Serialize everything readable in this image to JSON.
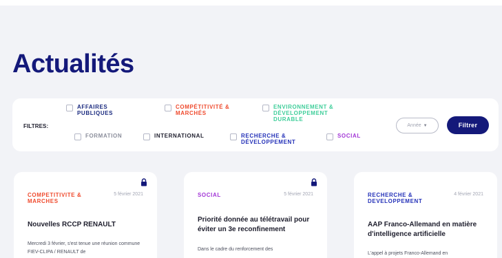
{
  "page": {
    "title": "Actualités"
  },
  "filters": {
    "label": "FILTRES:",
    "items": [
      {
        "label": "AFFAIRES PUBLIQUES"
      },
      {
        "label": "COMPÉTITIVITÉ & MARCHÉS"
      },
      {
        "label": "ENVIRONNEMENT & DÉVELOPPEMENT DURABLE"
      },
      {
        "label": "FORMATION"
      },
      {
        "label": "INTERNATIONAL"
      },
      {
        "label": "RECHERCHE & DÉVELOPPEMENT"
      },
      {
        "label": "SOCIAL"
      }
    ],
    "year_select": {
      "value": "Année"
    },
    "submit_label": "Filtrer"
  },
  "articles": [
    {
      "category": "COMPETITIVITE & MARCHES",
      "date": "5 février 2021",
      "locked": true,
      "title": "Nouvelles RCCP RENAULT",
      "excerpt": "Mercredi 3 février, s'est tenue une réunion commune FIEV-CLIPA / RENAULT de"
    },
    {
      "category": "SOCIAL",
      "date": "5 février 2021",
      "locked": true,
      "title": "Priorité donnée au télétravail pour éviter un 3e reconfinement",
      "excerpt": "Dans le cadre du renforcement des"
    },
    {
      "category": "RECHERCHE & DEVELOPPEMENT",
      "date": "4 février 2021",
      "locked": false,
      "title": "AAP Franco-Allemand en matière d'intelligence artificielle",
      "excerpt": "L'appel à projets Franco-Allemand en"
    }
  ],
  "colors": {
    "brand": "#14197a",
    "background": "#f2f3f7",
    "competitivite": "#ef4a2d",
    "environnement": "#3fce9a",
    "recherche": "#2330b8",
    "social": "#a235d6"
  }
}
